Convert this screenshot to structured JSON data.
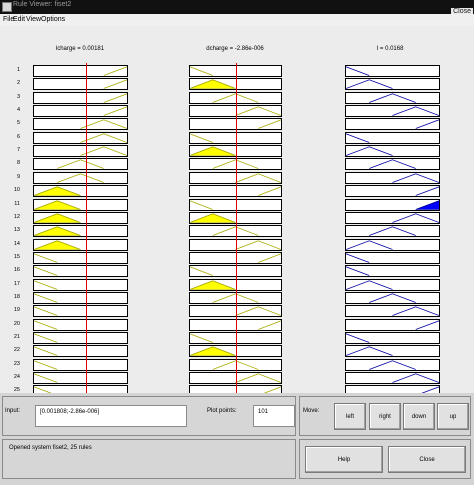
{
  "window": {
    "title": "Rule Viewer: fiset2",
    "close_hint": "Close"
  },
  "menu": [
    "File",
    "Edit",
    "View",
    "Options"
  ],
  "inputs_header": [
    {
      "name": "lcharge",
      "value": "0.00181",
      "title": "lcharge = 0.00181"
    },
    {
      "name": "dcharge",
      "value": "-2.86e-006",
      "title": "dcharge = -2.86e-006"
    }
  ],
  "output_header": {
    "name": "I",
    "value": "0.0168",
    "title": "I = 0.0168"
  },
  "rule_count": 25,
  "rows": [
    "1",
    "2",
    "3",
    "4",
    "5",
    "6",
    "7",
    "8",
    "9",
    "10",
    "11",
    "12",
    "13",
    "14",
    "15",
    "16",
    "17",
    "18",
    "19",
    "20",
    "21",
    "22",
    "23",
    "24",
    "25"
  ],
  "rules": {
    "lcharge_mf": [
      4,
      4,
      4,
      4,
      3,
      3,
      3,
      2,
      2,
      1,
      1,
      1,
      1,
      1,
      0,
      0,
      0,
      0,
      0,
      0,
      0,
      0,
      0,
      0,
      0
    ],
    "dcharge_mf": [
      0,
      1,
      2,
      3,
      4,
      0,
      1,
      2,
      3,
      4,
      0,
      1,
      2,
      3,
      4,
      0,
      1,
      2,
      3,
      4,
      0,
      1,
      2,
      3,
      4
    ],
    "lcharge_firing": [
      0,
      0,
      0,
      0,
      0,
      0,
      0,
      0,
      0,
      0.95,
      0.95,
      0.95,
      0.95,
      0.95,
      0,
      0,
      0,
      0,
      0,
      0,
      0,
      0,
      0,
      0,
      0
    ],
    "dcharge_firing": [
      0,
      0.95,
      0,
      0,
      0,
      0,
      0.95,
      0,
      0,
      0,
      0,
      0.95,
      0,
      0,
      0,
      0,
      0.95,
      0,
      0,
      0,
      0,
      0.95,
      0,
      0,
      0
    ],
    "output_mf": [
      0,
      1,
      2,
      3,
      4,
      0,
      1,
      2,
      3,
      4,
      4,
      3,
      2,
      1,
      0,
      0,
      1,
      2,
      3,
      4,
      0,
      1,
      2,
      3,
      4
    ],
    "output_firing": [
      0,
      0,
      0,
      0,
      0,
      0,
      0,
      0,
      0,
      0,
      0.95,
      0,
      0,
      0,
      0,
      0,
      0,
      0,
      0,
      0,
      0,
      0,
      0,
      0,
      0
    ]
  },
  "input_values_frac": [
    0.56,
    0.5
  ],
  "output_value_frac": 0.5,
  "aggregate_peak": 0.25,
  "controls": {
    "input_label": "Input:",
    "input_value": "[0.001808;-2.86e-006]",
    "plot_points_label": "Plot points:",
    "plot_points_value": "101",
    "move_label": "Move:",
    "left": "left",
    "right": "right",
    "down": "down",
    "up": "up",
    "status": "Opened system fiset2, 25 rules",
    "help": "Help",
    "close": "Close"
  },
  "colors": {
    "input_mf_line": "#a8a800",
    "input_fill": "#ffff00",
    "output_mf_line": "#0000a0",
    "output_fill": "#0000ff",
    "input_line": "#e00000",
    "output_line": "#e00000"
  }
}
